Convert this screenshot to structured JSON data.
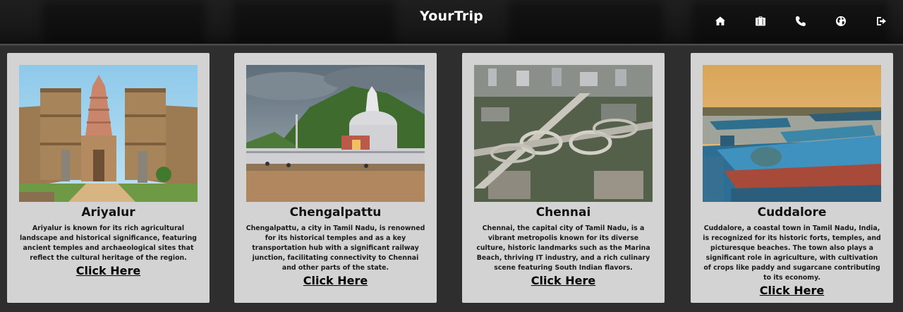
{
  "navbar": {
    "brand": "YourTrip",
    "icons": [
      "home-icon",
      "briefcase-icon",
      "phone-icon",
      "globe-icon",
      "logout-icon"
    ]
  },
  "cards": [
    {
      "title": "Ariyalur",
      "description": "Ariyalur is known for its rich agricultural landscape and historical significance, featuring ancient temples and archaeological sites that reflect the cultural heritage of the region.",
      "link": "Click Here"
    },
    {
      "title": "Chengalpattu",
      "description": "Chengalpattu, a city in Tamil Nadu, is renowned for its historical temples and as a key transportation hub with a significant railway junction, facilitating connectivity to Chennai and other parts of the state.",
      "link": "Click Here"
    },
    {
      "title": "Chennai",
      "description": "Chennai, the capital city of Tamil Nadu, is a vibrant metropolis known for its diverse culture, historic landmarks such as the Marina Beach, thriving IT industry, and a rich culinary scene featuring South Indian flavors.",
      "link": "Click Here"
    },
    {
      "title": "Cuddalore",
      "description": "Cuddalore, a coastal town in Tamil Nadu, India, is recognized for its historic forts, temples, and picturesque beaches. The town also plays a significant role in agriculture, with cultivation of crops like paddy and sugarcane contributing to its economy.",
      "link": "Click Here"
    }
  ]
}
